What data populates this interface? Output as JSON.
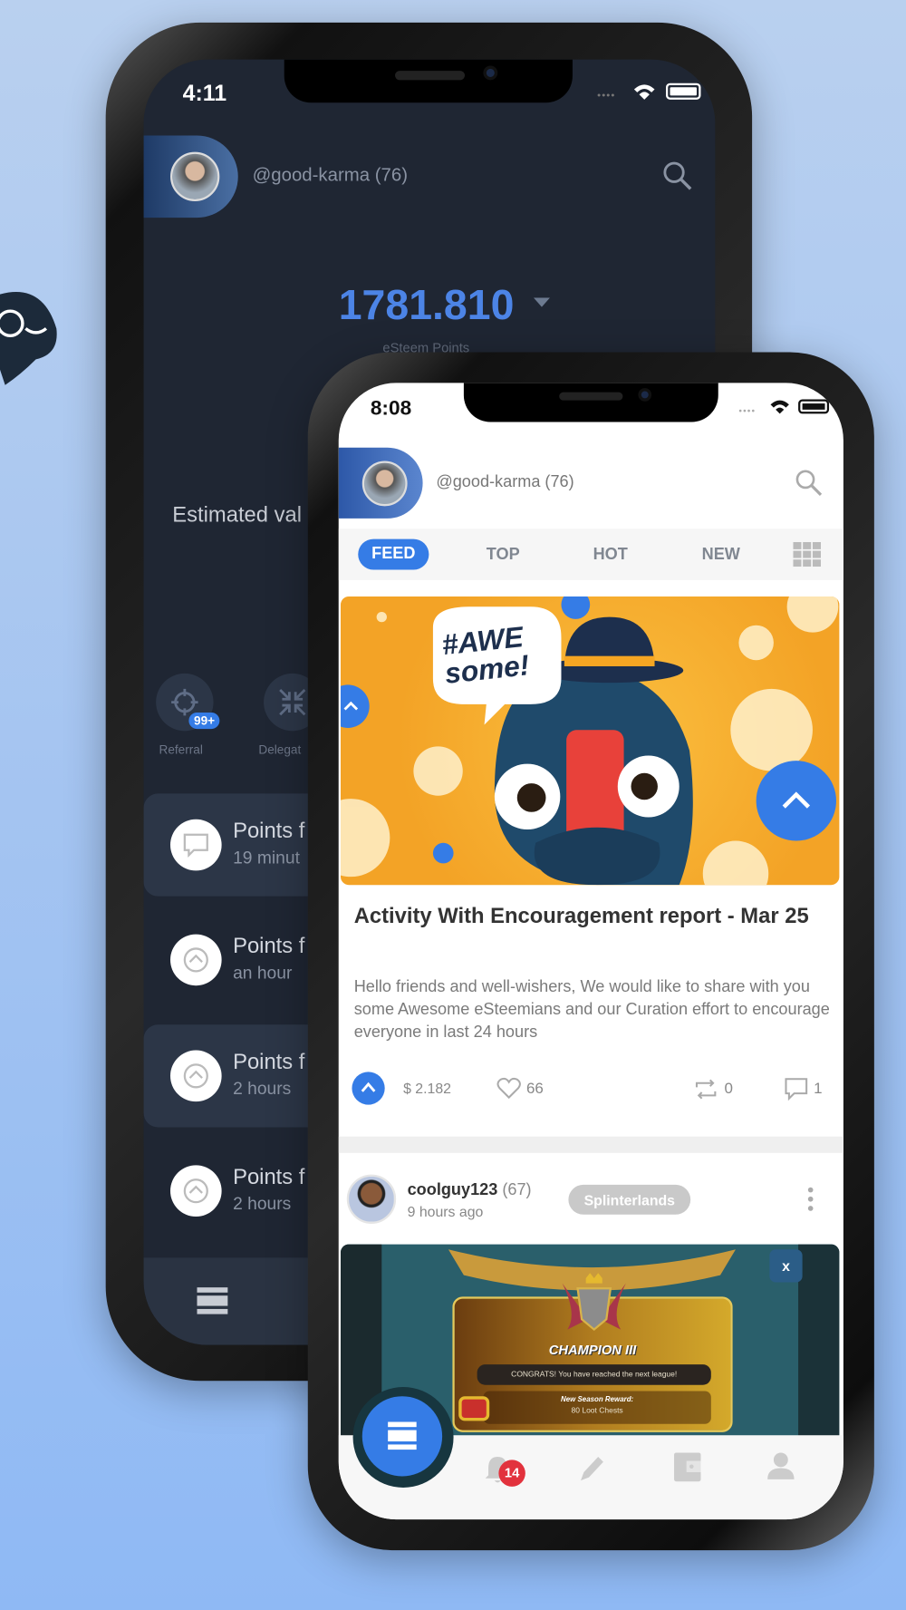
{
  "mascot_icon": "esteem-whale-logo",
  "back_phone": {
    "status_time": "4:11",
    "username": "@good-karma (76)",
    "balance": "1781.810",
    "balance_label": "eSteem Points",
    "estimated_label": "Estimated val",
    "actions": [
      {
        "label": "Referral",
        "badge": "99+",
        "icon": "target-icon"
      },
      {
        "label": "Delegat",
        "icon": "delegation-icon"
      }
    ],
    "rows": [
      {
        "title": "Points f",
        "sub": "19 minut",
        "icon": "comment-icon",
        "highlight": true
      },
      {
        "title": "Points f",
        "sub": "an hour",
        "icon": "upvote-icon",
        "highlight": false
      },
      {
        "title": "Points f",
        "sub": "2 hours",
        "icon": "upvote-icon",
        "highlight": true
      },
      {
        "title": "Points f",
        "sub": "2 hours",
        "icon": "upvote-icon",
        "highlight": false
      }
    ]
  },
  "front_phone": {
    "status_time": "8:08",
    "username": "@good-karma (76)",
    "tabs": [
      {
        "label": "FEED",
        "active": true
      },
      {
        "label": "TOP"
      },
      {
        "label": "HOT"
      },
      {
        "label": "NEW"
      }
    ],
    "post1": {
      "image_text": "#AWE some!",
      "title": "Activity With Encouragement report - Mar 25",
      "body": "Hello friends and well-wishers, We would like to share with you some Awesome eSteemians and our Curation effort to encourage everyone in last 24 hours",
      "payout": "$ 2.182",
      "votes": "66",
      "reblogs": "0",
      "comments": "1"
    },
    "post2": {
      "author": "coolguy123",
      "reputation": "(67)",
      "time": "9 hours ago",
      "tag": "Splinterlands",
      "image": {
        "title": "CHAMPION III",
        "congrats": "CONGRATS! You have reached the next league!",
        "reward_label": "New Season Reward:",
        "reward": "80 Loot Chests"
      }
    },
    "nav": {
      "notification_badge": "14"
    }
  },
  "colors": {
    "accent": "#357ce6",
    "dark_bg": "#1f2633",
    "badge_red": "#e2323d",
    "image_orange": "#f5a623"
  }
}
